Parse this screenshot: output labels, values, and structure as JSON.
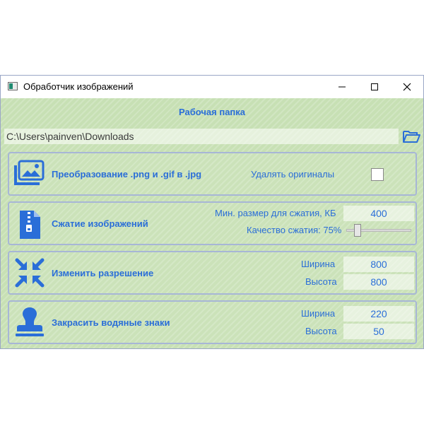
{
  "window": {
    "title": "Обработчик изображений"
  },
  "folder": {
    "label": "Рабочая папка",
    "path": "C:\\Users\\painven\\Downloads"
  },
  "convert": {
    "title": "Преобразование .png и .gif в .jpg",
    "delete_label": "Удалять оригиналы",
    "delete_checked": false
  },
  "compress": {
    "title": "Сжатие изображений",
    "min_size_label": "Мин. размер для сжатия, КБ",
    "min_size_value": "400",
    "quality_label": "Качество сжатия: 75%",
    "quality_value": 75
  },
  "resize": {
    "title": "Изменить разрешение",
    "width_label": "Ширина",
    "width_value": "800",
    "height_label": "Высота",
    "height_value": "800"
  },
  "watermark": {
    "title": "Закрасить водяные знаки",
    "width_label": "Ширина",
    "width_value": "220",
    "height_label": "Высота",
    "height_value": "50"
  },
  "colors": {
    "accent": "#2a6ed8",
    "background": "#c7e0b4",
    "panel_border": "#a7b6d6"
  },
  "icons": [
    "app-icon",
    "minimize-icon",
    "maximize-icon",
    "close-icon",
    "folder-open-icon",
    "images-icon",
    "zip-file-icon",
    "compress-arrows-icon",
    "stamp-icon"
  ]
}
